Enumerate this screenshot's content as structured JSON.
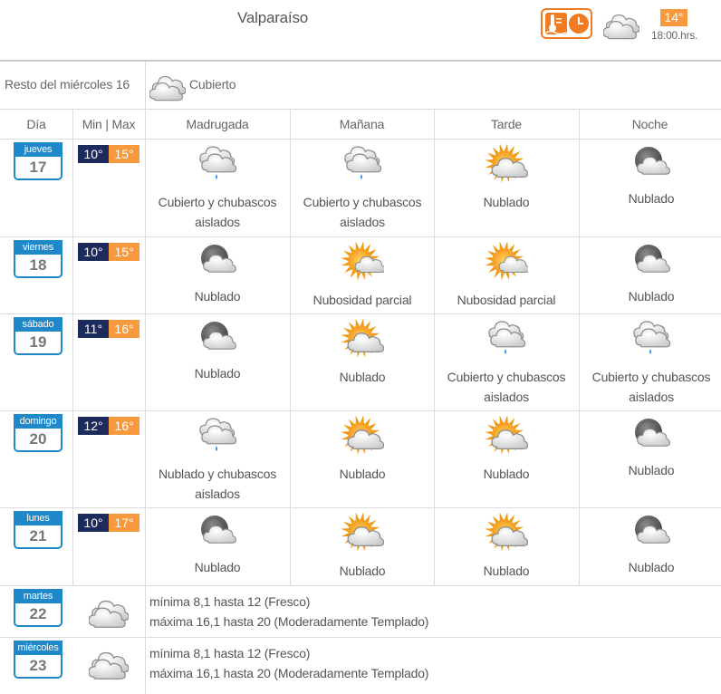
{
  "header": {
    "city": "Valparaíso",
    "current_temp": "14°",
    "current_time": "18:00.hrs.",
    "current_icon": "cloudy-icon",
    "colors": {
      "accent_orange": "#f79a3f",
      "brand_blue": "#1e88c8",
      "min_navy": "#1d2a5c"
    }
  },
  "rest": {
    "label": "Resto del miércoles 16",
    "condition": "Cubierto",
    "icon": "cloudy-icon"
  },
  "columns": [
    "Día",
    "Min | Max",
    "Madrugada",
    "Mañana",
    "Tarde",
    "Noche"
  ],
  "days": [
    {
      "name": "jueves",
      "num": "17",
      "min": "10°",
      "max": "15°",
      "periods": [
        {
          "icon": "cloud-rain-icon",
          "text_1": "Cubierto y chubascos",
          "text_2": "aislados"
        },
        {
          "icon": "cloud-rain-icon",
          "text_1": "Cubierto y chubascos",
          "text_2": "aislados"
        },
        {
          "icon": "sun-cloud-icon",
          "text_1": "Nublado",
          "text_2": ""
        },
        {
          "icon": "moon-cloud-icon",
          "text_1": "Nublado",
          "text_2": ""
        }
      ]
    },
    {
      "name": "viernes",
      "num": "18",
      "min": "10°",
      "max": "15°",
      "periods": [
        {
          "icon": "moon-cloud-icon",
          "text_1": "Nublado",
          "text_2": ""
        },
        {
          "icon": "sun-partial-icon",
          "text_1": "Nubosidad parcial",
          "text_2": ""
        },
        {
          "icon": "sun-partial-icon",
          "text_1": "Nubosidad parcial",
          "text_2": ""
        },
        {
          "icon": "moon-cloud-icon",
          "text_1": "Nublado",
          "text_2": ""
        }
      ]
    },
    {
      "name": "sábado",
      "num": "19",
      "min": "11°",
      "max": "16°",
      "periods": [
        {
          "icon": "moon-cloud-icon",
          "text_1": "Nublado",
          "text_2": ""
        },
        {
          "icon": "sun-cloud-icon",
          "text_1": "Nublado",
          "text_2": ""
        },
        {
          "icon": "cloud-rain-icon",
          "text_1": "Cubierto y chubascos",
          "text_2": "aislados"
        },
        {
          "icon": "cloud-rain-icon",
          "text_1": "Cubierto y chubascos",
          "text_2": "aislados"
        }
      ]
    },
    {
      "name": "domingo",
      "num": "20",
      "min": "12°",
      "max": "16°",
      "periods": [
        {
          "icon": "cloud-rain-icon",
          "text_1": "Nublado y chubascos",
          "text_2": "aislados"
        },
        {
          "icon": "sun-cloud-icon",
          "text_1": "Nublado",
          "text_2": ""
        },
        {
          "icon": "sun-cloud-icon",
          "text_1": "Nublado",
          "text_2": ""
        },
        {
          "icon": "moon-cloud-icon",
          "text_1": "Nublado",
          "text_2": ""
        }
      ]
    },
    {
      "name": "lunes",
      "num": "21",
      "min": "10°",
      "max": "17°",
      "periods": [
        {
          "icon": "moon-cloud-icon",
          "text_1": "Nublado",
          "text_2": ""
        },
        {
          "icon": "sun-cloud-icon",
          "text_1": "Nublado",
          "text_2": ""
        },
        {
          "icon": "sun-cloud-icon",
          "text_1": "Nublado",
          "text_2": ""
        },
        {
          "icon": "moon-cloud-icon",
          "text_1": "Nublado",
          "text_2": ""
        }
      ]
    }
  ],
  "extended": [
    {
      "name": "martes",
      "num": "22",
      "icon": "cloudy-icon",
      "line_1": "mínima 8,1 hasta 12 (Fresco)",
      "line_2": "máxima 16,1 hasta 20 (Moderadamente Templado)"
    },
    {
      "name": "miércoles",
      "num": "23",
      "icon": "cloudy-icon",
      "line_1": "mínima 8,1 hasta 12 (Fresco)",
      "line_2": "máxima 16,1 hasta 20 (Moderadamente Templado)"
    }
  ]
}
